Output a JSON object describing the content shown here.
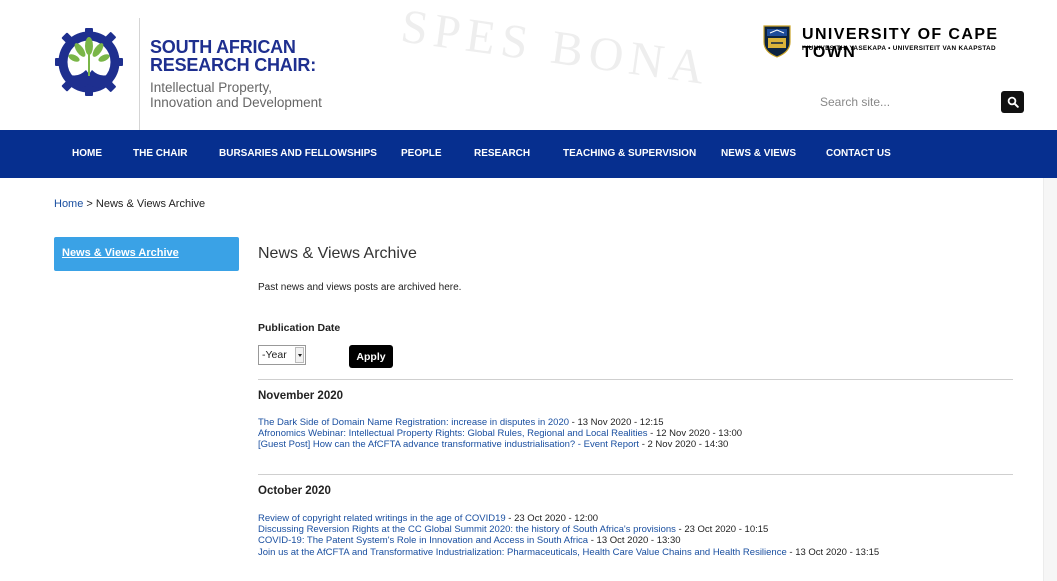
{
  "header": {
    "watermark": "SPES BONA",
    "chair_title_line1": "SOUTH AFRICAN",
    "chair_title_line2": "RESEARCH CHAIR:",
    "chair_sub_line1": "Intellectual Property,",
    "chair_sub_line2": "Innovation and Development",
    "university_name": "UNIVERSITY OF CAPE TOWN",
    "university_sub": "IYUNIVESITHI YASEKAPA • UNIVERSITEIT VAN KAAPSTAD"
  },
  "search": {
    "placeholder": "Search site..."
  },
  "nav": {
    "items": [
      {
        "label": "HOME"
      },
      {
        "label": "THE CHAIR"
      },
      {
        "label": "BURSARIES AND FELLOWSHIPS"
      },
      {
        "label": "PEOPLE"
      },
      {
        "label": "RESEARCH"
      },
      {
        "label": "TEACHING & SUPERVISION"
      },
      {
        "label": "NEWS & VIEWS"
      },
      {
        "label": "CONTACT US"
      }
    ]
  },
  "breadcrumb": {
    "home": "Home",
    "separator": ">",
    "current": "News & Views Archive"
  },
  "sidebar": {
    "items": [
      {
        "label": "News & Views Archive"
      }
    ]
  },
  "main": {
    "title": "News & Views Archive",
    "intro": "Past news and views posts are archived here.",
    "filter": {
      "label": "Publication Date",
      "year_value": "-Year",
      "apply_label": "Apply"
    },
    "months": [
      {
        "heading": "November 2020",
        "posts": [
          {
            "title": "The Dark Side of Domain Name Registration: increase in disputes in 2020",
            "date": "- 13 Nov 2020 - 12:15"
          },
          {
            "title": "Afronomics Webinar: Intellectual Property Rights: Global Rules, Regional and Local Realities",
            "date": "- 12 Nov 2020 - 13:00"
          },
          {
            "title": "[Guest Post] How can the AfCFTA advance transformative industrialisation? - Event Report",
            "date": "- 2 Nov 2020 - 14:30"
          }
        ]
      },
      {
        "heading": "October 2020",
        "posts": [
          {
            "title": "Review of copyright related writings in the age of COVID19",
            "date": "- 23 Oct 2020 - 12:00"
          },
          {
            "title": "Discussing Reversion Rights at the CC Global Summit 2020: the history of South Africa's provisions",
            "date": "- 23 Oct 2020 - 10:15"
          },
          {
            "title": "COVID-19: The Patent System's Role in Innovation and Access in South Africa",
            "date": "- 13 Oct 2020 - 13:30"
          },
          {
            "title": "Join us at the AfCFTA and Transformative Industrialization: Pharmaceuticals, Health Care Value Chains and Health Resilience",
            "date": "- 13 Oct 2020 - 13:15"
          }
        ]
      }
    ]
  },
  "colors": {
    "nav_bg": "#062f8f",
    "brand_blue": "#1e2f8f",
    "sidebar_active": "#3aa2e6",
    "link": "#1a4fa0"
  },
  "icons": {
    "search": "search-icon",
    "chair_logo": "hands-gear-leaves-logo",
    "uct_crest": "uct-crest-icon"
  }
}
